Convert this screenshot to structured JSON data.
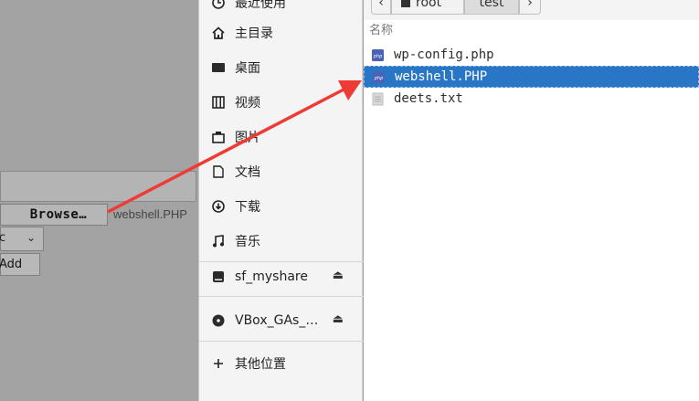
{
  "background": {
    "browse_label": "Browse…",
    "selected_filename": "webshell.PHP",
    "select_chevron": "⌄",
    "add_label": "Add"
  },
  "sidebar": {
    "items": [
      {
        "label": "最近使用",
        "icon": "clock-icon"
      },
      {
        "label": "主目录",
        "icon": "home-icon"
      },
      {
        "label": "桌面",
        "icon": "desktop-icon"
      },
      {
        "label": "视频",
        "icon": "video-icon"
      },
      {
        "label": "图片",
        "icon": "picture-icon"
      },
      {
        "label": "文档",
        "icon": "document-icon"
      },
      {
        "label": "下载",
        "icon": "download-icon"
      },
      {
        "label": "音乐",
        "icon": "music-icon"
      },
      {
        "label": "sf_myshare",
        "icon": "drive-icon"
      },
      {
        "label": "VBox_GAs_…",
        "icon": "disc-icon"
      },
      {
        "label": "其他位置",
        "icon": "plus-icon"
      }
    ],
    "eject_icon": "⏏"
  },
  "pathbar": {
    "root_label": "root",
    "current_label": "test"
  },
  "filelist": {
    "column_header": "名称",
    "files": [
      {
        "name": "wp-config.php",
        "icon": "php-file-icon"
      },
      {
        "name": "webshell.PHP",
        "icon": "php-file-icon",
        "selected": true
      },
      {
        "name": "deets.txt",
        "icon": "text-file-icon"
      }
    ]
  },
  "colors": {
    "selection": "#2a76c6",
    "annotation_arrow": "#ee3b35"
  }
}
